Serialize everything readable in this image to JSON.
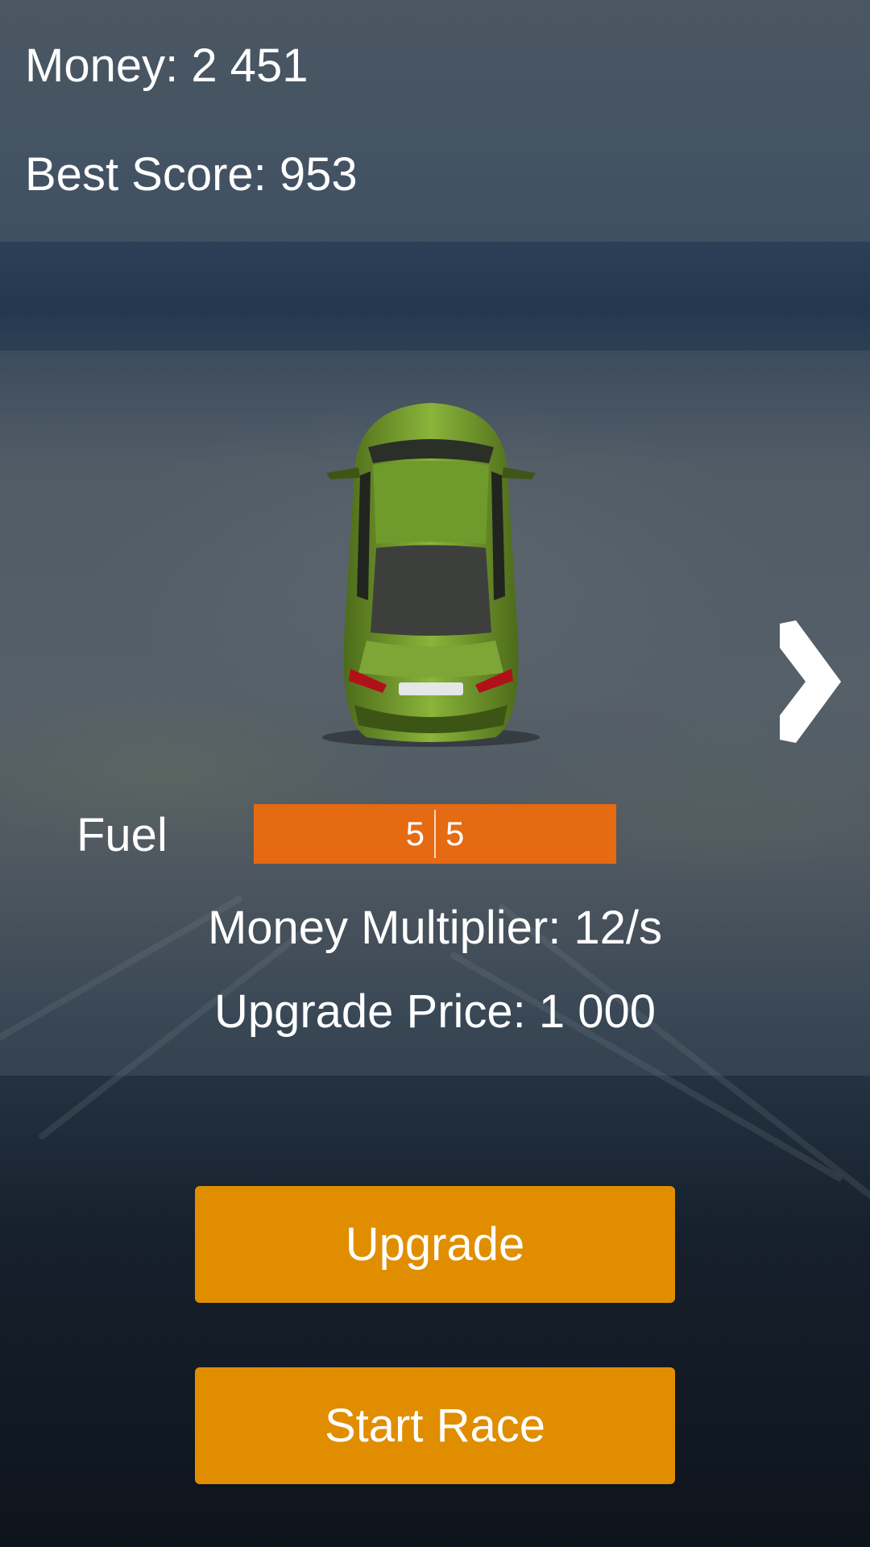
{
  "header": {
    "money_text": "Money: 2 451",
    "best_score_text": "Best Score: 953"
  },
  "car": {
    "color": "#7aa02e",
    "icon": "car-top-view-icon"
  },
  "navigation": {
    "next_icon": "chevron-right-icon"
  },
  "stats": {
    "fuel_label": "Fuel",
    "fuel_current": "5",
    "fuel_max": "5",
    "fuel_level": 1.0,
    "money_multiplier_text": "Money Multiplier:  12/s",
    "upgrade_price_text": "Upgrade Price: 1 000"
  },
  "buttons": {
    "upgrade_label": "Upgrade",
    "start_race_label": "Start Race"
  },
  "colors": {
    "button": "#e08e00",
    "fuel_bar": "#e56a12"
  }
}
